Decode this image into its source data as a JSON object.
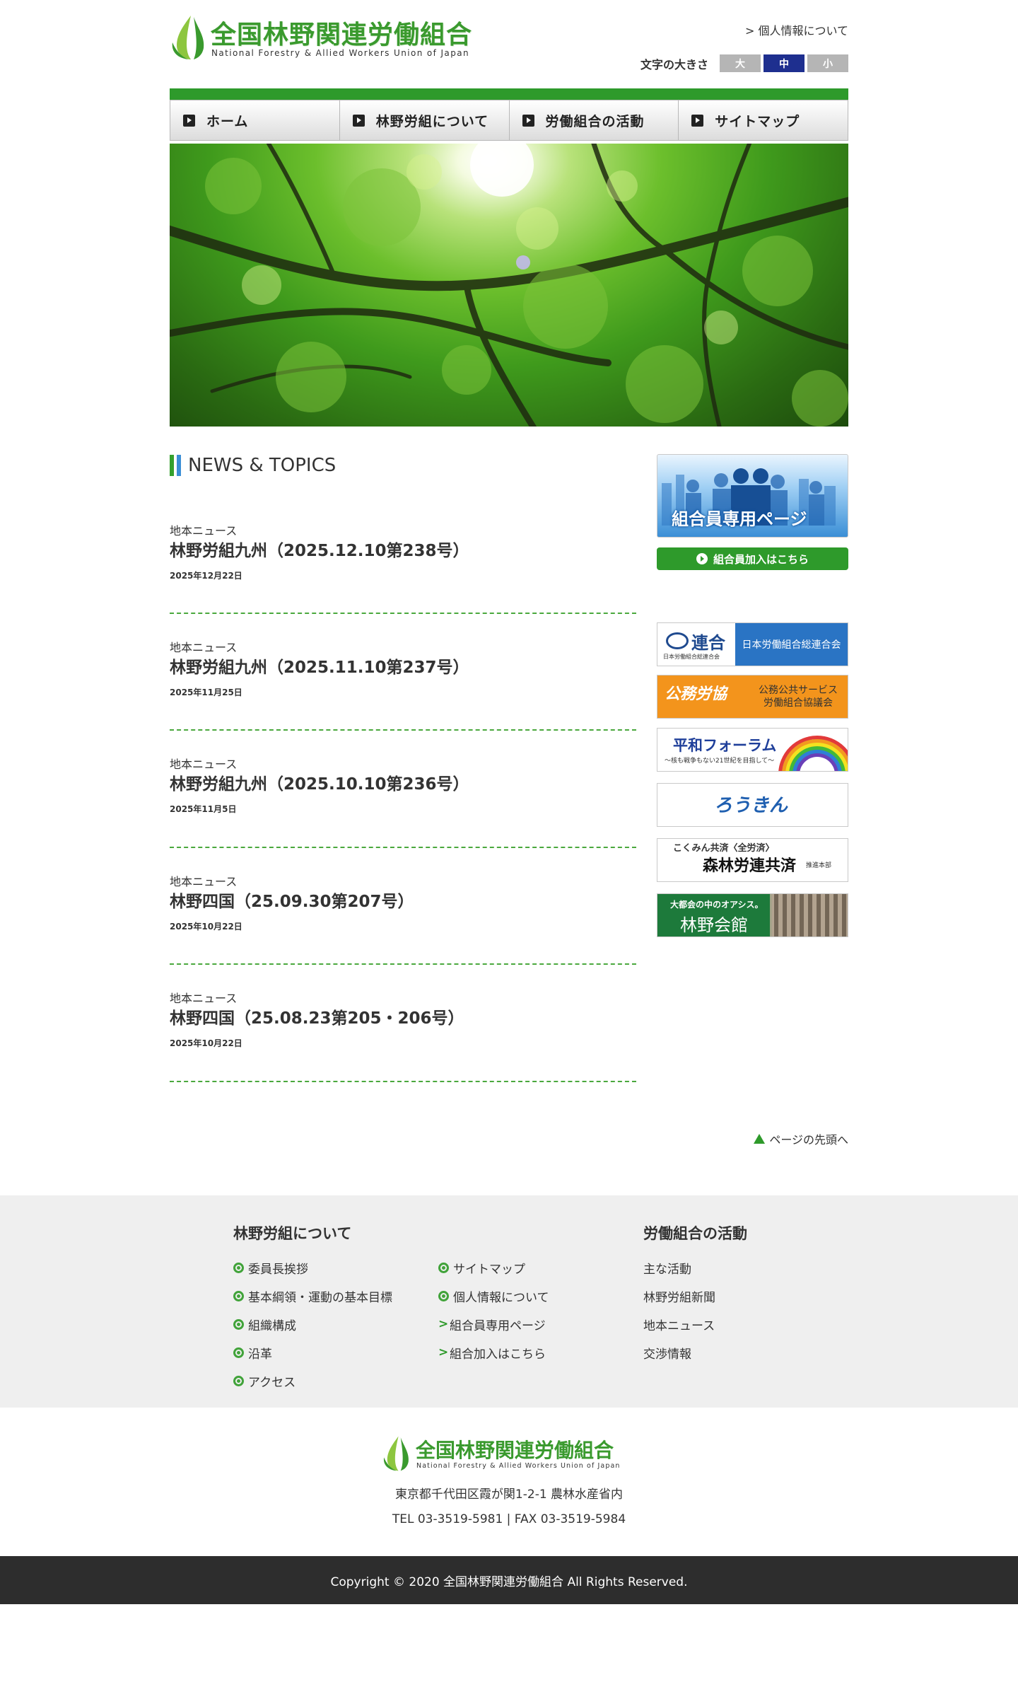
{
  "header": {
    "logo_title": "全国林野関連労働組合",
    "logo_subtitle": "National Forestry & Allied Workers Union of Japan",
    "privacy_link": "> 個人情報について",
    "font_size_label": "文字の大きさ",
    "font_size_options": [
      "大",
      "中",
      "小"
    ],
    "font_size_selected": "中"
  },
  "nav": {
    "items": [
      {
        "label": "ホーム"
      },
      {
        "label": "林野労組について"
      },
      {
        "label": "労働組合の活動"
      },
      {
        "label": "サイトマップ"
      }
    ]
  },
  "news": {
    "heading": "NEWS & TOPICS",
    "items": [
      {
        "category": "地本ニュース",
        "title": "林野労組九州（2025.12.10第238号）",
        "date": "2025年12月22日"
      },
      {
        "category": "地本ニュース",
        "title": "林野労組九州（2025.11.10第237号）",
        "date": "2025年11月25日"
      },
      {
        "category": "地本ニュース",
        "title": "林野労組九州（2025.10.10第236号）",
        "date": "2025年11月5日"
      },
      {
        "category": "地本ニュース",
        "title": "林野四国（25.09.30第207号）",
        "date": "2025年10月22日"
      },
      {
        "category": "地本ニュース",
        "title": "林野四国（25.08.23第205・206号）",
        "date": "2025年10月22日"
      }
    ]
  },
  "sidebar": {
    "member_banner_label": "組合員専用ページ",
    "join_button_label": "組合員加入はこちら",
    "banners": {
      "rengo_logo": "連合",
      "rengo_sub": "日本労働組合総連合会",
      "rengo_text": "日本労働組合総連合会",
      "komu_logo": "公務労協",
      "komu_text": "公務公共サービス\n労働組合協議会",
      "heiwa_title": "平和フォーラム",
      "heiwa_sub": "〜核も戦争もない21世紀を目指して〜",
      "rokin": "ろうきん",
      "shinrin_top": "こくみん共済〈全労済〉",
      "shinrin_main": "森林労連共済",
      "shinrin_suffix": "推進本部",
      "kaikan_sub": "大都会の中のオアシス。",
      "kaikan_title": "林野会館"
    }
  },
  "pagetop_label": "ページの先頭へ",
  "footer_nav": {
    "col1_heading": "林野労組について",
    "col1_links": [
      "委員長挨拶",
      "基本綱領・運動の基本目標",
      "組織構成",
      "沿革",
      "アクセス"
    ],
    "col2_links": [
      {
        "label": "サイトマップ",
        "icon": "dot"
      },
      {
        "label": "個人情報について",
        "icon": "dot"
      },
      {
        "label": "組合員専用ページ",
        "icon": "chevron"
      },
      {
        "label": "組合加入はこちら",
        "icon": "chevron"
      }
    ],
    "col3_heading": "労働組合の活動",
    "col3_links": [
      "主な活動",
      "林野労組新聞",
      "地本ニュース",
      "交渉情報"
    ]
  },
  "footer": {
    "logo_title": "全国林野関連労働組合",
    "logo_subtitle": "National Forestry & Allied Workers Union of Japan",
    "address": "東京都千代田区霞が関1-2-1 農林水産省内",
    "contact": "TEL 03-3519-5981 | FAX 03-3519-5984",
    "copyright": "Copyright © 2020 全国林野関連労働組合 All Rights Reserved."
  },
  "colors": {
    "brand_green": "#2e9a2b",
    "accent_blue": "#3b8fd6",
    "font_size_active": "#1e2f8f"
  }
}
